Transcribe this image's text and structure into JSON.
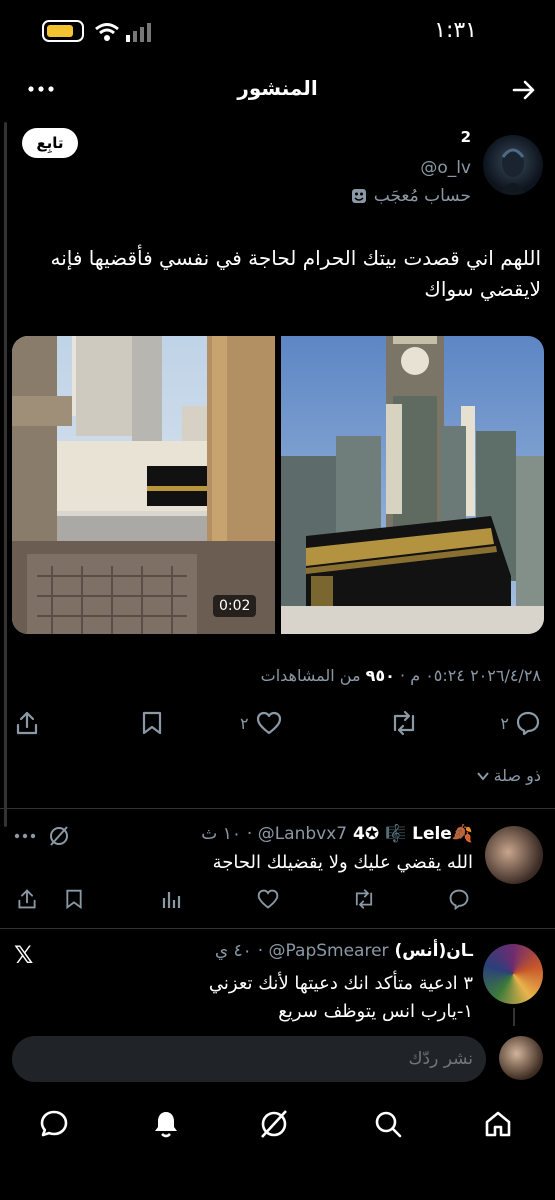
{
  "status_bar": {
    "time": "١:٣١"
  },
  "header": {
    "title": "المنشور"
  },
  "post": {
    "display_name": "2",
    "handle": "@o_lv",
    "parody_label": "حساب مُعجَب",
    "follow_label": "تابِع",
    "text": "اللهم اني قصدت بيتك الحرام لحاجة في نفسي فأقضيها فإنه لايقضي سواك",
    "video_duration": "0:02",
    "meta": {
      "date_time": "٢٠٢٦/٤/٢٨ ٠٥:٢٤ م",
      "views_count": "٩٥٠",
      "views_label": "من المشاهدات"
    },
    "actions": {
      "reply_count": "٢",
      "like_count": "٢"
    },
    "related_label": "ذو صلة"
  },
  "replies": [
    {
      "name": "4✪ 🎼 Lele🍂",
      "handle": "@Lanbvx7",
      "time": "١٠ ث",
      "text": "الله يقضي عليك ولا يقضيلك الحاجة"
    },
    {
      "name": "(أنس)ـان",
      "handle": "@PapSmearer",
      "time": "٤٠ ي",
      "text_line1": "٣ ادعية متأكد انك دعيتها لأنك تعزني",
      "text_line2": "١-يارب انس يتوظف سريع"
    }
  ],
  "composer": {
    "placeholder": "نشر ردّك"
  },
  "icons": {
    "x_logo": "𝕏"
  }
}
